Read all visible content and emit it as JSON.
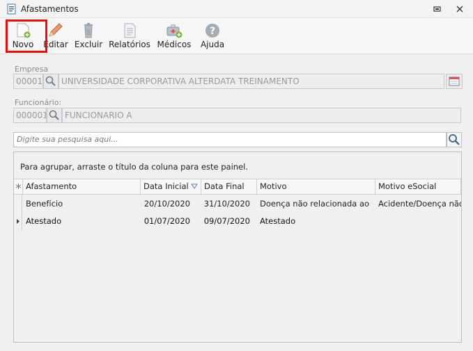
{
  "window": {
    "title": "Afastamentos",
    "controls": [
      "restore",
      "close"
    ]
  },
  "toolbar": {
    "buttons": [
      {
        "label": "Novo",
        "icon": "new-document-icon"
      },
      {
        "label": "Editar",
        "icon": "edit-pencil-icon"
      },
      {
        "label": "Excluir",
        "icon": "trash-icon"
      },
      {
        "label": "Relatórios",
        "icon": "report-icon"
      },
      {
        "label": "Médicos",
        "icon": "medical-kit-icon"
      },
      {
        "label": "Ajuda",
        "icon": "help-icon"
      }
    ],
    "highlight_color": "#e41010"
  },
  "empresa": {
    "label": "Empresa",
    "code": "00001",
    "name": "UNIVERSIDADE CORPORATIVA ALTERDATA TREINAMENTO"
  },
  "funcionario": {
    "label": "Funcionário:",
    "code": "000001",
    "name": "FUNCIONARIO A"
  },
  "search": {
    "placeholder": "Digite sua pesquisa aqui..."
  },
  "grid": {
    "group_panel_text": "Para agrupar, arraste o título da coluna para este painel.",
    "columns": [
      "Afastamento",
      "Data Inicial",
      "Data Final",
      "Motivo",
      "Motivo eSocial"
    ],
    "sort_column": "Data Inicial",
    "rows": [
      {
        "afastamento": "Benefício",
        "data_inicial": "20/10/2020",
        "data_final": "31/10/2020",
        "motivo": "Doença não relacionada ao",
        "motivo_esocial": "Acidente/Doença não",
        "selected": false
      },
      {
        "afastamento": "Atestado",
        "data_inicial": "01/07/2020",
        "data_final": "09/07/2020",
        "motivo": "Atestado",
        "motivo_esocial": "",
        "selected": true
      }
    ]
  },
  "colors": {
    "icon_green": "#7cb342",
    "icon_grey": "#9aa3ad"
  }
}
